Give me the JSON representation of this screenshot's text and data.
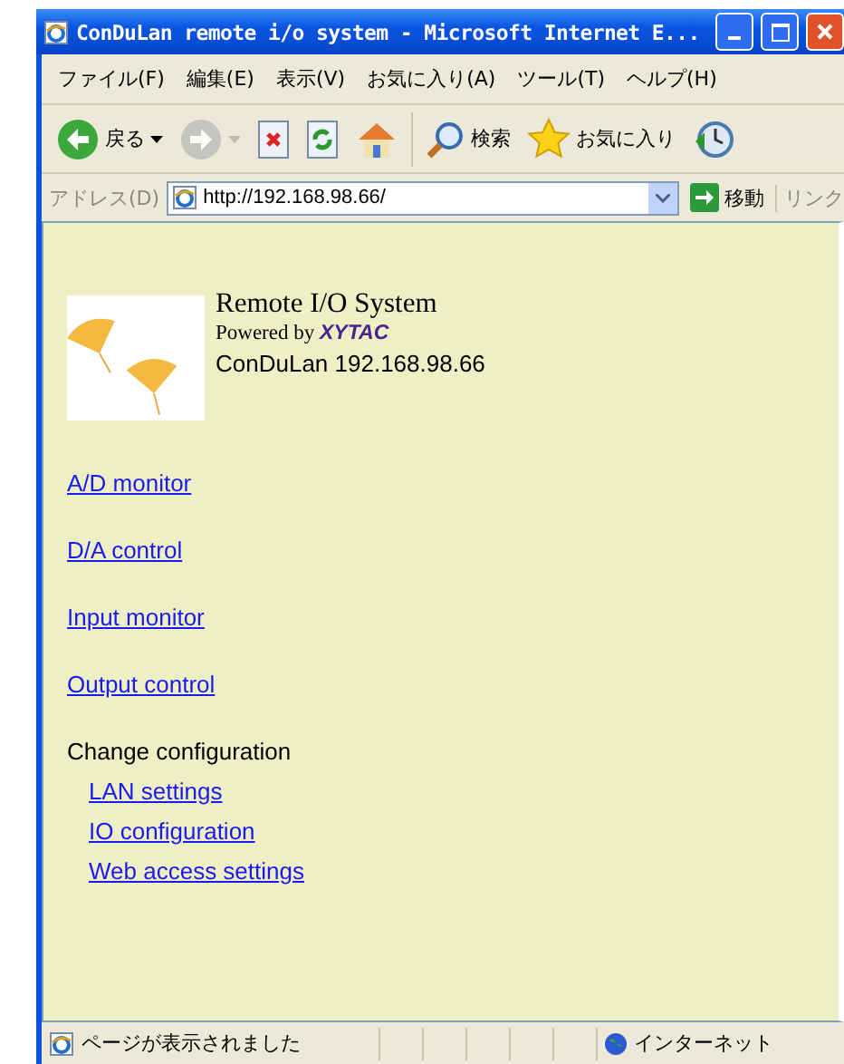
{
  "window": {
    "title": "ConDuLan remote i/o system - Microsoft Internet E..."
  },
  "menu": [
    "ファイル(F)",
    "編集(E)",
    "表示(V)",
    "お気に入り(A)",
    "ツール(T)",
    "ヘルプ(H)"
  ],
  "toolbar": [
    {
      "kind": "back",
      "label": "戻る",
      "disabled": false
    },
    {
      "kind": "forward",
      "disabled": true
    },
    {
      "kind": "stop"
    },
    {
      "kind": "refresh"
    },
    {
      "kind": "home"
    },
    {
      "kind": "search",
      "label": "検索"
    },
    {
      "kind": "favorites",
      "label": "お気に入り"
    },
    {
      "kind": "history"
    }
  ],
  "address": {
    "label": "アドレス(D)",
    "value": "http://192.168.98.66/",
    "go": "移動",
    "links": "リンク"
  },
  "header": {
    "title": "Remote I/O System",
    "powered_by": "Powered by",
    "brand": "XYTAC",
    "device": "ConDuLan 192.168.98.66"
  },
  "links": [
    "A/D monitor",
    "D/A control",
    "Input monitor",
    "Output control"
  ],
  "config": {
    "heading": "Change configuration",
    "links": [
      "LAN settings",
      "IO configuration",
      "Web access settings"
    ]
  },
  "status_bar": {
    "message": "ページが表示されました",
    "zone": "インターネット"
  }
}
